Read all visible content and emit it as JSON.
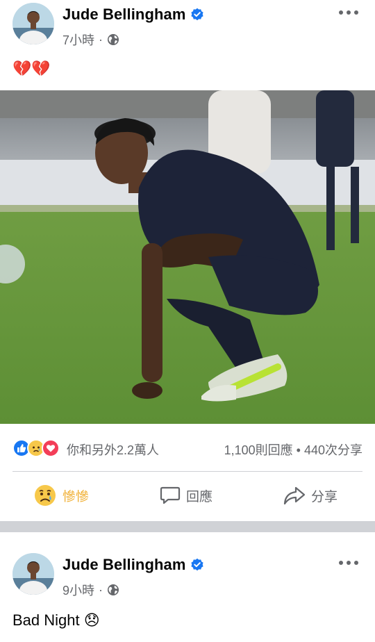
{
  "post1": {
    "author": "Jude Bellingham",
    "time": "7小時",
    "separator": "·",
    "text": "💔💔",
    "stats": {
      "reactions_text": "你和另外2.2萬人",
      "comments_shares_text": "1,100則回應 • 440次分享"
    },
    "actions": {
      "react_label": "慘慘",
      "comment_label": "回應",
      "share_label": "分享"
    }
  },
  "post2": {
    "author": "Jude Bellingham",
    "time": "9小時",
    "separator": "·",
    "text": "Bad Night 😞"
  },
  "icons": {
    "verified": "verified-badge-icon",
    "privacy": "globe-icon",
    "more": "more-options-icon",
    "reactions": [
      "like-icon",
      "sad-icon",
      "love-icon"
    ],
    "react_action": "sad-face-icon",
    "comment": "comment-icon",
    "share": "share-icon"
  },
  "colors": {
    "facebook_blue": "#1877f2",
    "sad_yellow": "#f0ad2d",
    "love_red": "#f33e58",
    "secondary_text": "#65676b"
  }
}
